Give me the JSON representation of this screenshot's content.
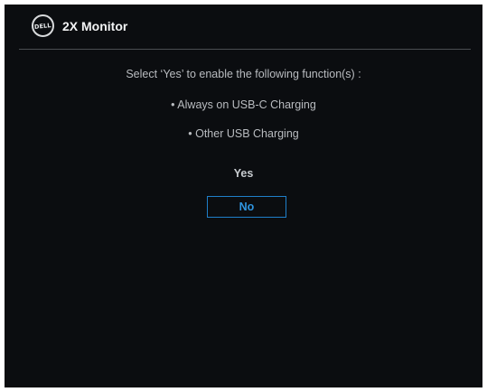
{
  "header": {
    "logo_text": "DELL",
    "title": "2X Monitor"
  },
  "dialog": {
    "prompt": "Select ‘Yes’ to enable the following function(s) :",
    "functions": [
      "• Always on USB-C Charging",
      "• Other USB Charging"
    ],
    "options": {
      "yes_label": "Yes",
      "no_label": "No",
      "selected": "No"
    }
  },
  "colors": {
    "background": "#0b0d10",
    "accent": "#1f7fc9",
    "text": "#b9bcc0"
  }
}
